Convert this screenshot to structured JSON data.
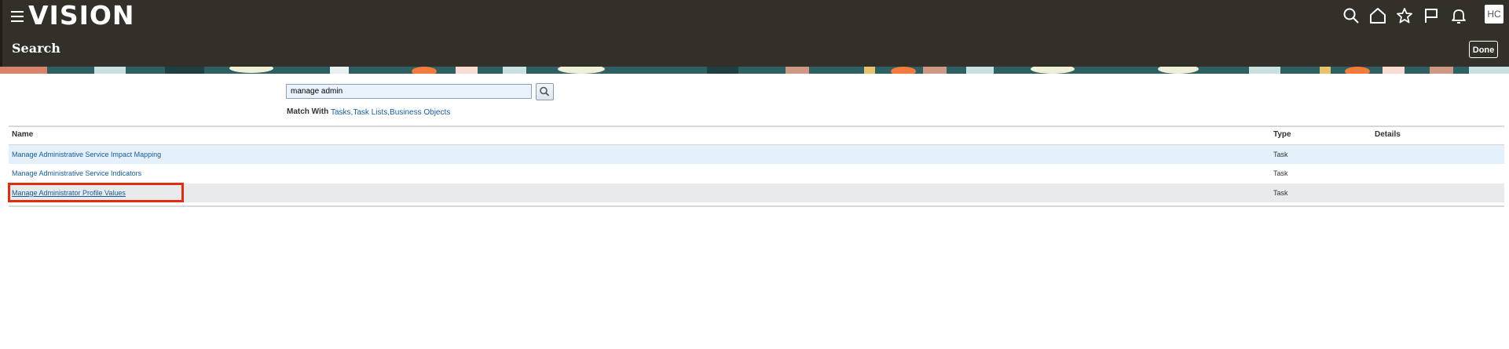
{
  "header": {
    "logo": "VISION",
    "page_title": "Search",
    "avatar_initials": "HC",
    "done_label": "Done",
    "icons": [
      "search-icon",
      "home-icon",
      "star-icon",
      "flag-icon",
      "bell-icon"
    ]
  },
  "search": {
    "query": "manage admin",
    "match_with_label": "Match With",
    "match_with_value": "Tasks,Task Lists,Business Objects"
  },
  "table": {
    "headers": {
      "name": "Name",
      "type": "Type",
      "details": "Details"
    },
    "rows": [
      {
        "name": "Manage Administrative Service Impact Mapping",
        "type": "Task",
        "details": ""
      },
      {
        "name": "Manage Administrative Service Indicators",
        "type": "Task",
        "details": ""
      },
      {
        "name": "Manage Administrator Profile Values",
        "type": "Task",
        "details": ""
      }
    ]
  },
  "colors": {
    "header_bg": "#332f29",
    "link": "#145c9e",
    "row_selected_bg": "#e4f0fa",
    "row_hover_bg": "#e9eaeb",
    "highlight_border": "#e12c12"
  }
}
